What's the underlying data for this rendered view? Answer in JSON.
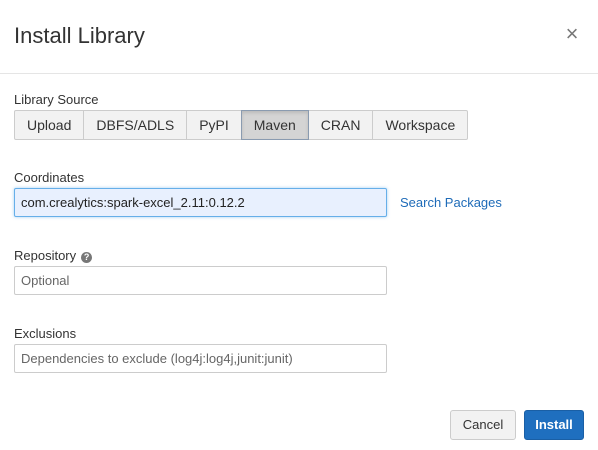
{
  "dialog": {
    "title": "Install Library",
    "close_glyph": "×"
  },
  "library_source": {
    "label": "Library Source",
    "options": [
      "Upload",
      "DBFS/ADLS",
      "PyPI",
      "Maven",
      "CRAN",
      "Workspace"
    ],
    "selected": "Maven"
  },
  "coordinates": {
    "label": "Coordinates",
    "value": "com.crealytics:spark-excel_2.11:0.12.2",
    "search_link": "Search Packages"
  },
  "repository": {
    "label": "Repository",
    "help_icon": "?",
    "placeholder": "Optional",
    "value": ""
  },
  "exclusions": {
    "label": "Exclusions",
    "placeholder": "Dependencies to exclude (log4j:log4j,junit:junit)",
    "value": ""
  },
  "footer": {
    "cancel_label": "Cancel",
    "install_label": "Install"
  },
  "colors": {
    "primary": "#1f6fbf",
    "link": "#1e6bb8",
    "focused_input_bg": "#e8f0fe"
  }
}
